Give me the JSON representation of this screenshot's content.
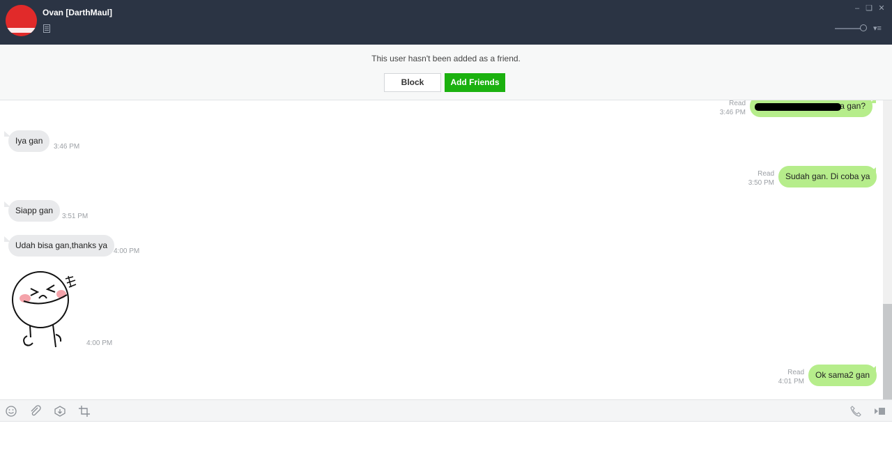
{
  "header": {
    "contact_name": "Ovan [DarthMaul]",
    "colors": {
      "bar": "#2b3444",
      "avatar": "#e12a2a"
    },
    "window_controls": [
      "minimize-icon",
      "restore-icon",
      "close-icon"
    ],
    "menu_icon": "hamburger-menu-icon"
  },
  "friend_notice": {
    "text": "This user hasn't been added as a friend.",
    "block_label": "Block",
    "add_label": "Add Friends",
    "add_color": "#1bb10f"
  },
  "messages": [
    {
      "side": "out",
      "text": "ya gan?",
      "status": "Read",
      "time": "3:46 PM",
      "redacted": true
    },
    {
      "side": "in",
      "text": "Iya gan",
      "time": "3:46 PM"
    },
    {
      "side": "out",
      "text": "Sudah gan. Di coba ya",
      "status": "Read",
      "time": "3:50 PM"
    },
    {
      "side": "in",
      "text": "Siapp gan",
      "time": "3:51 PM"
    },
    {
      "side": "in",
      "text": "Udah bisa gan,thanks ya",
      "time": "4:00 PM"
    },
    {
      "side": "in",
      "type": "sticker",
      "sticker": "laughing-moon-sticker",
      "time": "4:00 PM"
    },
    {
      "side": "out",
      "text": "Ok sama2 gan",
      "status": "Read",
      "time": "4:01 PM"
    }
  ],
  "toolbar": {
    "left_icons": [
      "emoji-icon",
      "attach-icon",
      "download-icon",
      "crop-icon"
    ],
    "right_icons": [
      "phone-icon",
      "video-call-icon"
    ]
  },
  "colors": {
    "outgoing_bubble": "#b6ed8b",
    "incoming_bubble": "#e9eaec"
  }
}
